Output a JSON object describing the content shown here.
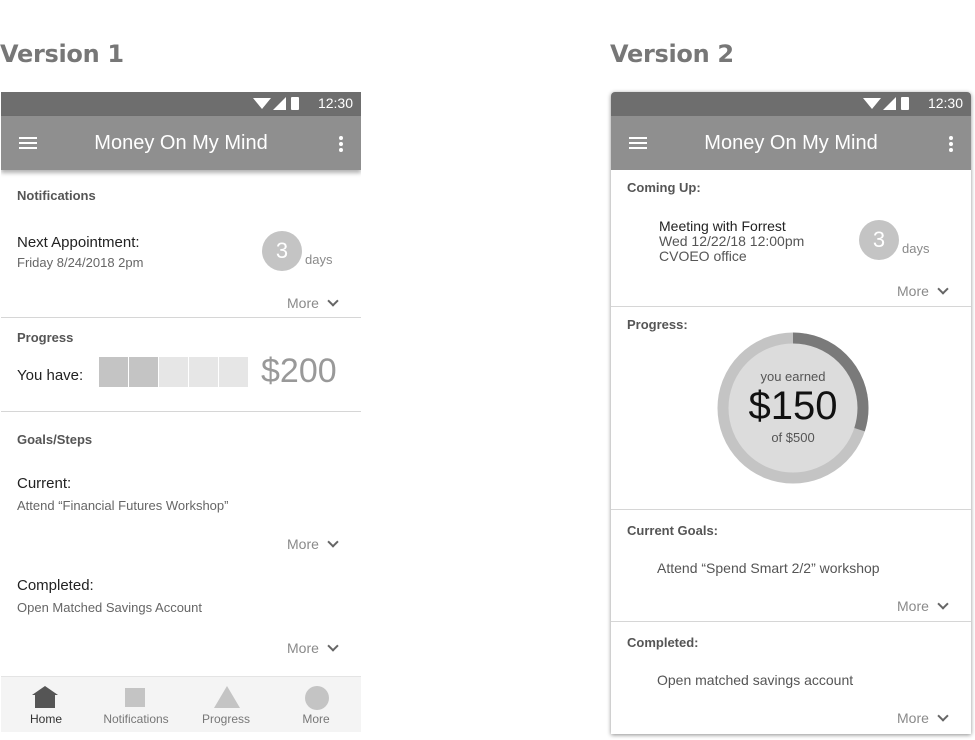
{
  "versions": [
    {
      "title": "Version 1",
      "status_time": "12:30",
      "app_title": "Money On My Mind",
      "notifications": {
        "label": "Notifications",
        "heading": "Next Appointment:",
        "detail": "Friday 8/24/2018 2pm",
        "count": "3",
        "unit": "days",
        "more": "More"
      },
      "progress": {
        "label": "Progress",
        "have_label": "You have:",
        "amount": "$200",
        "filled_segments": 2,
        "total_segments": 5
      },
      "goals": {
        "label": "Goals/Steps",
        "current_heading": "Current:",
        "current_detail": "Attend “Financial Futures Workshop”",
        "current_more": "More",
        "completed_heading": "Completed:",
        "completed_detail": "Open Matched Savings Account",
        "completed_more": "More"
      },
      "nav": [
        {
          "label": "Home",
          "icon": "home-icon",
          "active": true
        },
        {
          "label": "Notifications",
          "icon": "square-icon",
          "active": false
        },
        {
          "label": "Progress",
          "icon": "triangle-icon",
          "active": false
        },
        {
          "label": "More",
          "icon": "circle-icon",
          "active": false
        }
      ]
    },
    {
      "title": "Version 2",
      "status_time": "12:30",
      "app_title": "Money On My Mind",
      "coming_up": {
        "label": "Coming Up:",
        "line1": "Meeting with Forrest",
        "line2": "Wed 12/22/18 12:00pm",
        "line3": "CVOEO office",
        "count": "3",
        "unit": "days",
        "more": "More"
      },
      "progress": {
        "label": "Progress:",
        "earned_label": "you earned",
        "amount": "$150",
        "goal_text": "of $500",
        "earned_value": 150,
        "goal_value": 500
      },
      "current_goals": {
        "label": "Current Goals:",
        "item": "Attend “Spend Smart 2/2” workshop",
        "more": "More"
      },
      "completed": {
        "label": "Completed:",
        "item": "Open matched savings account",
        "more": "More"
      }
    }
  ],
  "colors": {
    "status_bar": "#6e6e6e",
    "app_bar": "#8f8f8f",
    "segment_filled": "#c4c4c4",
    "segment_empty": "#e6e6e6",
    "ring_track": "#c4c4c4",
    "ring_progress": "#7a7a7a"
  }
}
